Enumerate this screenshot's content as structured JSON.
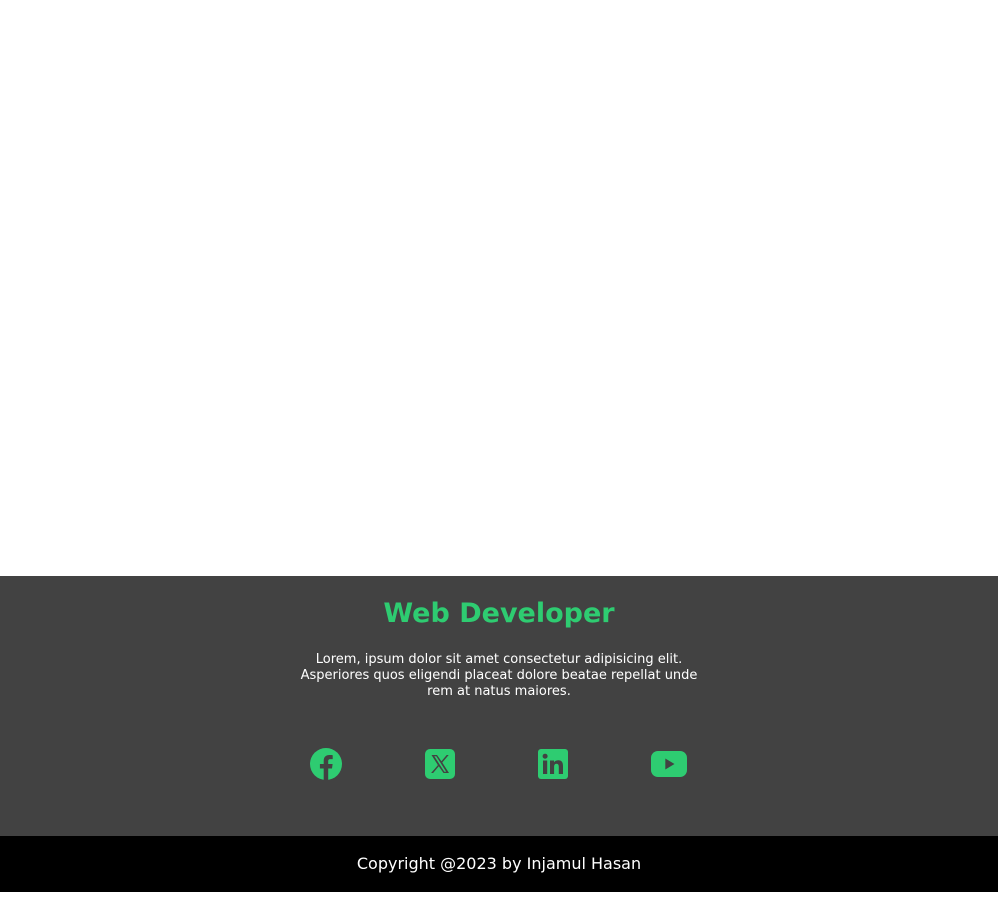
{
  "footer": {
    "title": "Web Developer",
    "description": "Lorem, ipsum dolor sit amet consectetur adipisicing elit. Asperiores quos eligendi placeat dolore beatae repellat unde rem at natus maiores.",
    "social_icons": [
      "facebook-icon",
      "x-twitter-icon",
      "linkedin-icon",
      "youtube-icon"
    ]
  },
  "copyright": {
    "text": "Copyright @2023 by Injamul Hasan"
  },
  "colors": {
    "accent": "#2ecc71",
    "footer_bg": "#424242",
    "copyright_bg": "#000000",
    "text": "#ffffff"
  }
}
